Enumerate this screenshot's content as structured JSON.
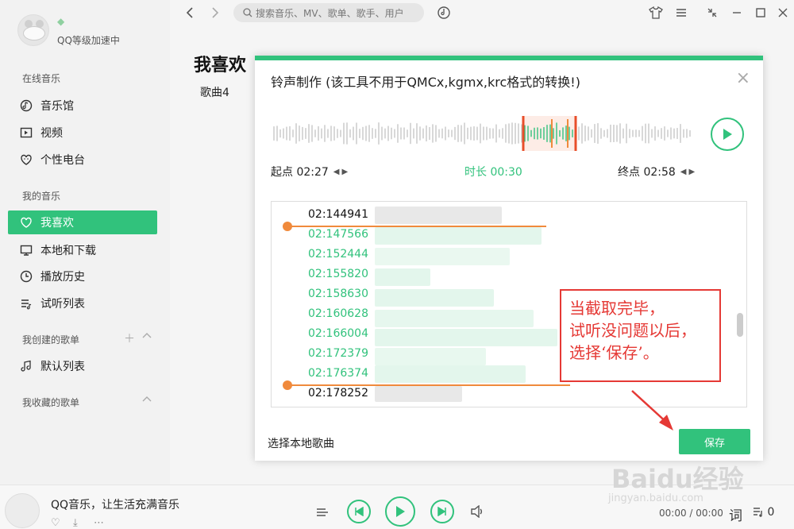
{
  "sidebar": {
    "level_text": "QQ等级加速中",
    "sections": {
      "online": "在线音乐",
      "mine": "我的音乐",
      "created": "我创建的歌单",
      "collected": "我收藏的歌单"
    },
    "items": [
      {
        "label": "音乐馆",
        "icon": "music-hall-icon"
      },
      {
        "label": "视频",
        "icon": "video-icon"
      },
      {
        "label": "个性电台",
        "icon": "radio-icon"
      },
      {
        "label": "我喜欢",
        "icon": "heart-icon",
        "active": true
      },
      {
        "label": "本地和下载",
        "icon": "monitor-icon"
      },
      {
        "label": "播放历史",
        "icon": "clock-icon"
      },
      {
        "label": "试听列表",
        "icon": "playlist-icon"
      },
      {
        "label": "默认列表",
        "icon": "note-icon"
      }
    ]
  },
  "topbar": {
    "search_placeholder": "搜索音乐、MV、歌单、歌手、用户"
  },
  "main": {
    "title": "我喜欢",
    "subtab": "歌曲4"
  },
  "dialog": {
    "title": "铃声制作 (该工具不用于QMCx,kgmx,krc格式的转换!)",
    "start_label": "起点 02:27",
    "duration_label": "时长 00:30",
    "end_label": "终点 02:58",
    "lyrics": [
      {
        "time": "02:144941",
        "style": "black"
      },
      {
        "time": "02:147566",
        "style": "green"
      },
      {
        "time": "02:152444",
        "style": "green"
      },
      {
        "time": "02:155820",
        "style": "green"
      },
      {
        "time": "02:158630",
        "style": "green"
      },
      {
        "time": "02:160628",
        "style": "green"
      },
      {
        "time": "02:166004",
        "style": "green"
      },
      {
        "time": "02:172379",
        "style": "green"
      },
      {
        "time": "02:176374",
        "style": "green"
      },
      {
        "time": "02:178252",
        "style": "black"
      }
    ],
    "local_song_label": "选择本地歌曲",
    "save_label": "保存"
  },
  "annotation": {
    "lines": [
      "当截取完毕，",
      "试听没问题以后，",
      "选择‘保存’。"
    ],
    "color": "#e53935"
  },
  "player": {
    "song_title": "QQ音乐，让生活充满音乐",
    "time": "00:00 / 00:00",
    "lyric_btn": "词",
    "queue_count": "0"
  },
  "watermark": {
    "text": "Baidu经验",
    "sub": "jingyan.baidu.com"
  },
  "colors": {
    "accent": "#31c27c",
    "marker": "#f08a3c",
    "selection": "#e53935"
  }
}
